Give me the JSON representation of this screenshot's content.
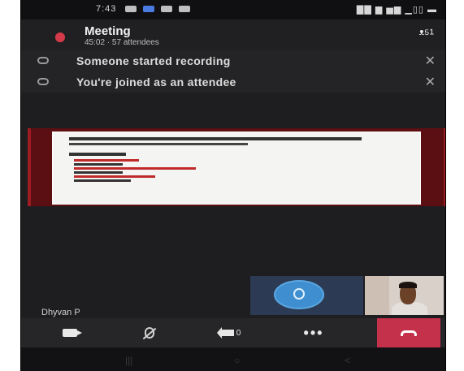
{
  "status_bar": {
    "time": "7:43",
    "right": "▇▇ ▆ ▅▆ ▁▯▯ ▬",
    "icons": [
      "signal-icon",
      "message-icon",
      "mail-icon",
      "more-dots-icon"
    ]
  },
  "header": {
    "title": "Meeting",
    "subtitle": "45:02 · 57 attendees",
    "people_icon": "ᵜ⁵¹"
  },
  "notices": [
    {
      "text": "Someone started recording",
      "close": "✕"
    },
    {
      "text": "You're joined as an attendee",
      "close": "✕"
    }
  ],
  "participant_name": "Dhyvan P",
  "controls": {
    "speaker_label": "0",
    "more": "•••"
  },
  "navbar": {
    "left": "|||",
    "center": "○",
    "right": "<"
  },
  "colors": {
    "hangup": "#c4314b",
    "rec_dot": "#d43b4a",
    "avatar": "#3f8fd0",
    "share_frame": "#9c1c22"
  }
}
